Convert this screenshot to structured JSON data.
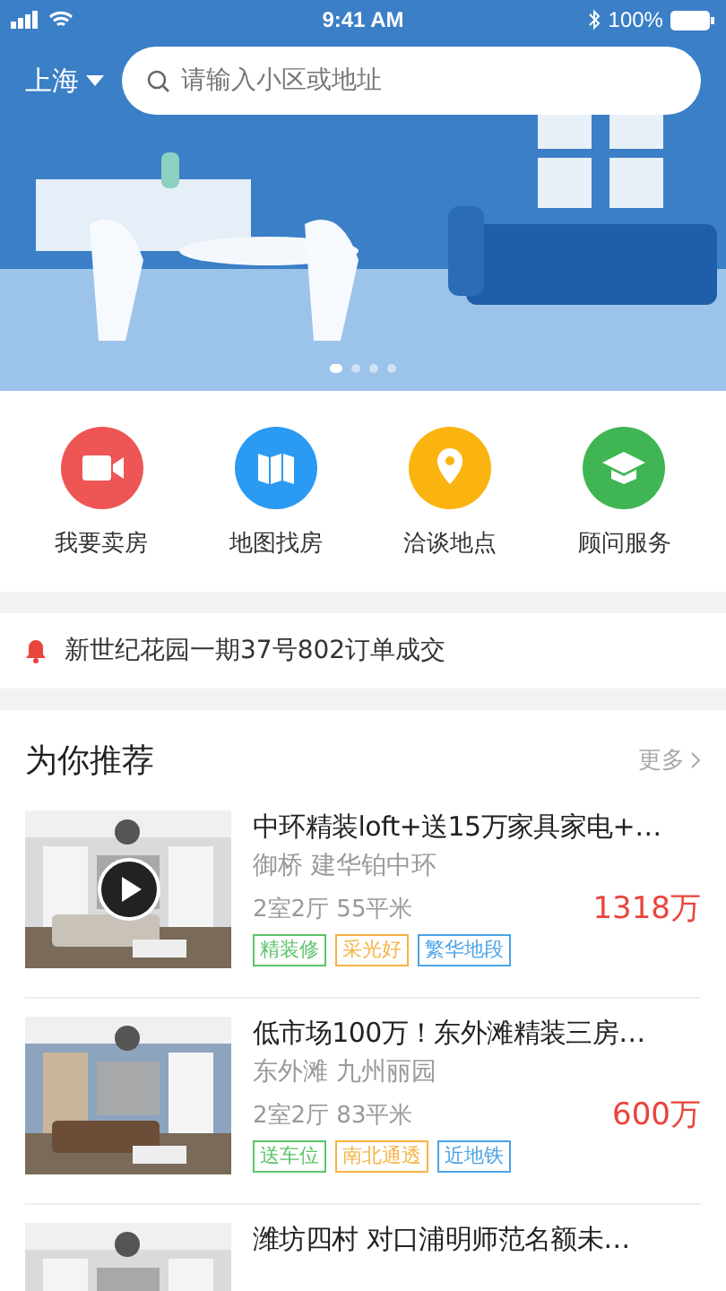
{
  "status_bar": {
    "time": "9:41 AM",
    "battery": "100%"
  },
  "header": {
    "city": "上海",
    "search": {
      "placeholder": "请输入小区或地址"
    }
  },
  "banner": {
    "kind": "picture",
    "dots": [
      {
        "selected": true
      },
      {
        "selected": false
      },
      {
        "selected": false
      },
      {
        "selected": false
      }
    ]
  },
  "shortcuts": [
    {
      "label": "我要卖房",
      "kind": "video",
      "color": "#ee5555"
    },
    {
      "label": "地图找房",
      "kind": "map",
      "color": "#2b9af3"
    },
    {
      "label": "洽谈地点",
      "kind": "pin",
      "color": "#fbb40f"
    },
    {
      "label": "顾问服务",
      "kind": "cap",
      "color": "#3fb653"
    }
  ],
  "notice": {
    "text": "新世纪花园一期37号802订单成交"
  },
  "recommend": {
    "title": "为你推荐",
    "more": "更多",
    "listings": [
      {
        "title": "中环精装loft+送15万家具家电+…",
        "area": "御桥  建华铂中环",
        "layout": "2室2厅 55平米",
        "price": "1318万",
        "video": true,
        "tags": [
          {
            "text": "精装修",
            "color": "#5cc36a"
          },
          {
            "text": "采光好",
            "color": "#f5b344"
          },
          {
            "text": "繁华地段",
            "color": "#4aa3e8"
          }
        ]
      },
      {
        "title": "低市场100万！东外滩精装三房…",
        "area": "东外滩  九州丽园",
        "layout": "2室2厅 83平米",
        "price": "600万",
        "video": false,
        "tags": [
          {
            "text": "送车位",
            "color": "#5cc36a"
          },
          {
            "text": "南北通透",
            "color": "#f5b344"
          },
          {
            "text": "近地铁",
            "color": "#4aa3e8"
          }
        ]
      },
      {
        "title": "潍坊四村 对口浦明师范名额未…",
        "video": false
      }
    ]
  }
}
